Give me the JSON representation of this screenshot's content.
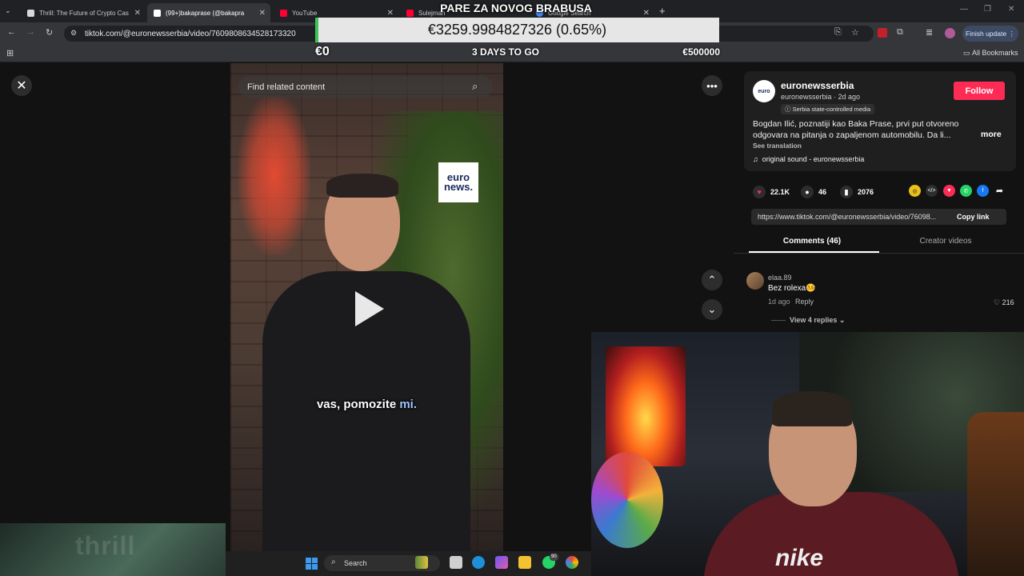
{
  "browser": {
    "tabs": [
      {
        "title": "Thrill: The Future of Crypto Cas",
        "color": "#d8d8d8"
      },
      {
        "title": "(99+)bakaprase (@bakapra",
        "color": "#ffffff",
        "active": true
      },
      {
        "title": "YouTube",
        "color": "#ff0033"
      },
      {
        "title": "Sulejman",
        "color": "#ff0033"
      },
      {
        "title": "Google Search",
        "color": "#4285f4"
      }
    ],
    "new_tab": "+",
    "url": "tiktok.com/@euronewsserbia/video/7609808634528173320",
    "finish_update": "Finish update",
    "all_bookmarks": "All Bookmarks"
  },
  "stream_overlay": {
    "goal_title": "PARE ZA NOVOG BRABUSA",
    "amount": "€3259.9984827326 (0.65%)",
    "goal_progress_pct": 0.65,
    "min_label": "€0",
    "days_left": "3 DAYS TO GO",
    "max_label": "€500000"
  },
  "video": {
    "search_placeholder": "Find related content",
    "logo_top": "euro",
    "logo_bottom": "news.",
    "subtitle_main": "vas, pomozite ",
    "subtitle_highlight": "mi."
  },
  "post": {
    "author": "euronewsserbia",
    "author_sub": "euronewsserbia · 2d ago",
    "badge": "Serbia state-controlled media",
    "follow": "Follow",
    "description": "Bogdan Ilić, poznatiji kao Baka Prase, prvi put otvoreno odgovara na pitanja o zapaljenom automobilu. Da li...",
    "more": "more",
    "see_translation": "See translation",
    "sound": "original sound - euronewsserbia",
    "likes": "22.1K",
    "comments": "46",
    "saves": "2076",
    "link": "https://www.tiktok.com/@euronewsserbia/video/76098...",
    "copy_link": "Copy link",
    "tab_comments": "Comments (46)",
    "tab_creator": "Creator videos"
  },
  "comment": {
    "user": "elaa.89",
    "text": "Bez rolexa🤒",
    "time": "1d ago",
    "reply": "Reply",
    "likes": "216",
    "view_replies": "View 4 replies"
  },
  "webcam": {
    "shirt_logo": "nike"
  },
  "overlay_bottom_left": {
    "text": "thrill"
  },
  "taskbar": {
    "search": "Search",
    "badge": "90"
  }
}
